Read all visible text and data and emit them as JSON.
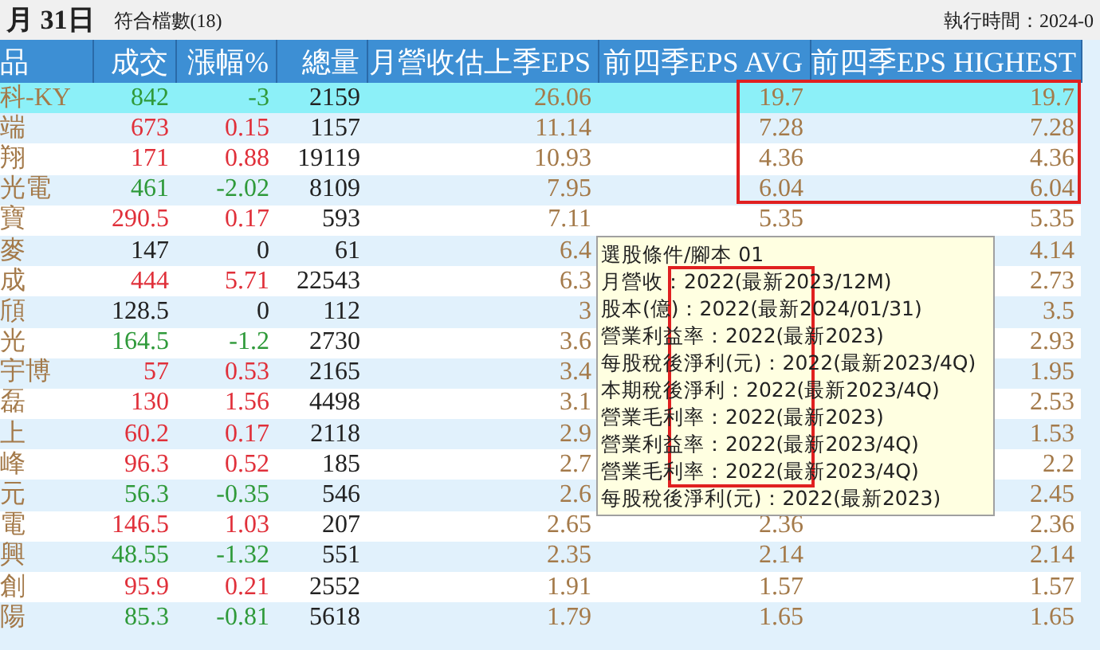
{
  "top_bar": {
    "date": "月 31日",
    "match_count": "符合檔數(18)",
    "run_time": "執行時間：2024-0"
  },
  "table": {
    "columns": [
      "品",
      "成交",
      "漲幅%",
      "總量",
      "月營收估上季EPS",
      "前四季EPS AVG",
      "前四季EPS HIGHEST"
    ],
    "rows": [
      {
        "name": "科-KY",
        "price": "842",
        "change": "-3",
        "volume": "2159",
        "month_eps": "26.06",
        "avg_eps": "19.7",
        "high_eps": "19.7",
        "color": "#2f9a3a",
        "selected": true
      },
      {
        "name": "端",
        "price": "673",
        "change": "0.15",
        "volume": "1157",
        "month_eps": "11.14",
        "avg_eps": "7.28",
        "high_eps": "7.28",
        "color": "#e0303a",
        "selected": false
      },
      {
        "name": "翔",
        "price": "171",
        "change": "0.88",
        "volume": "19119",
        "month_eps": "10.93",
        "avg_eps": "4.36",
        "high_eps": "4.36",
        "color": "#e0303a",
        "selected": false
      },
      {
        "name": "光電",
        "price": "461",
        "change": "-2.02",
        "volume": "8109",
        "month_eps": "7.95",
        "avg_eps": "6.04",
        "high_eps": "6.04",
        "color": "#2f9a3a",
        "selected": false
      },
      {
        "name": "寶",
        "price": "290.5",
        "change": "0.17",
        "volume": "593",
        "month_eps": "7.11",
        "avg_eps": "5.35",
        "high_eps": "5.35",
        "color": "#e0303a",
        "selected": false
      },
      {
        "name": "麥",
        "price": "147",
        "change": "0",
        "volume": "61",
        "month_eps": "6.4",
        "high_eps": "4.14",
        "color": "#222222",
        "selected": false
      },
      {
        "name": "成",
        "price": "444",
        "change": "5.71",
        "volume": "22543",
        "month_eps": "6.3",
        "high_eps": "2.73",
        "color": "#e0303a",
        "selected": false
      },
      {
        "name": "頎",
        "price": "128.5",
        "change": "0",
        "volume": "112",
        "month_eps": "3",
        "high_eps": "3.5",
        "color": "#222222",
        "selected": false
      },
      {
        "name": "光",
        "price": "164.5",
        "change": "-1.2",
        "volume": "2730",
        "month_eps": "3.6",
        "high_eps": "2.93",
        "color": "#2f9a3a",
        "selected": false
      },
      {
        "name": "宇博",
        "price": "57",
        "change": "0.53",
        "volume": "2165",
        "month_eps": "3.4",
        "high_eps": "1.95",
        "color": "#e0303a",
        "selected": false
      },
      {
        "name": "磊",
        "price": "130",
        "change": "1.56",
        "volume": "4498",
        "month_eps": "3.1",
        "high_eps": "2.53",
        "color": "#e0303a",
        "selected": false
      },
      {
        "name": "上",
        "price": "60.2",
        "change": "0.17",
        "volume": "2118",
        "month_eps": "2.9",
        "high_eps": "1.53",
        "color": "#e0303a",
        "selected": false
      },
      {
        "name": "峰",
        "price": "96.3",
        "change": "0.52",
        "volume": "185",
        "month_eps": "2.7",
        "high_eps": "2.2",
        "color": "#e0303a",
        "selected": false
      },
      {
        "name": "元",
        "price": "56.3",
        "change": "-0.35",
        "volume": "546",
        "month_eps": "2.6",
        "high_eps": "2.45",
        "color": "#2f9a3a",
        "selected": false
      },
      {
        "name": "電",
        "price": "146.5",
        "change": "1.03",
        "volume": "207",
        "month_eps": "2.65",
        "avg_eps": "2.36",
        "high_eps": "2.36",
        "color": "#e0303a",
        "selected": false
      },
      {
        "name": "興",
        "price": "48.55",
        "change": "-1.32",
        "volume": "551",
        "month_eps": "2.35",
        "avg_eps": "2.14",
        "high_eps": "2.14",
        "color": "#2f9a3a",
        "selected": false
      },
      {
        "name": "創",
        "price": "95.9",
        "change": "0.21",
        "volume": "2552",
        "month_eps": "1.91",
        "avg_eps": "1.57",
        "high_eps": "1.57",
        "color": "#e0303a",
        "selected": false
      },
      {
        "name": "陽",
        "price": "85.3",
        "change": "-0.81",
        "volume": "5618",
        "month_eps": "1.79",
        "avg_eps": "1.65",
        "high_eps": "1.65",
        "color": "#2f9a3a",
        "selected": false
      }
    ]
  },
  "tooltip": {
    "lines": [
      "選股條件/腳本 01",
      "月營收：2022(最新2023/12M)",
      "股本(億)：2022(最新2024/01/31)",
      "營業利益率：2022(最新2023)",
      "每股稅後淨利(元)：2022(最新2023/4Q)",
      "本期稅後淨利：2022(最新2023/4Q)",
      "營業毛利率：2022(最新2023)",
      "營業利益率：2022(最新2023/4Q)",
      "營業毛利率：2022(最新2023/4Q)",
      "每股稅後淨利(元)：2022(最新2023)"
    ]
  }
}
